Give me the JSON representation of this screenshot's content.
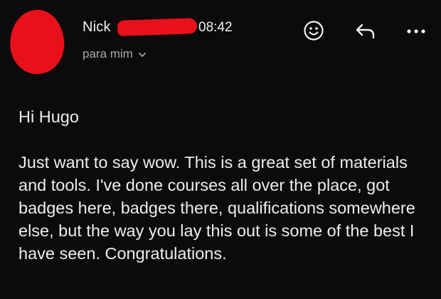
{
  "header": {
    "sender_first_name": "Nick",
    "time": "08:42",
    "recipient_label": "para mim",
    "icons": {
      "avatar": "avatar-redacted",
      "emoji": "smiley-face-icon",
      "reply": "reply-arrow-icon",
      "more": "more-horizontal-icon",
      "recipient_toggle": "chevron-down-icon"
    },
    "redaction_color": "#e8101b"
  },
  "message": {
    "greeting": "Hi Hugo",
    "body": "Just want to say wow. This is a great set of materials and tools. I've done courses all over the place, got badges here, badges there, qualifications somewhere else, but the way you lay this out is some of the best I have seen. Congratulations."
  }
}
